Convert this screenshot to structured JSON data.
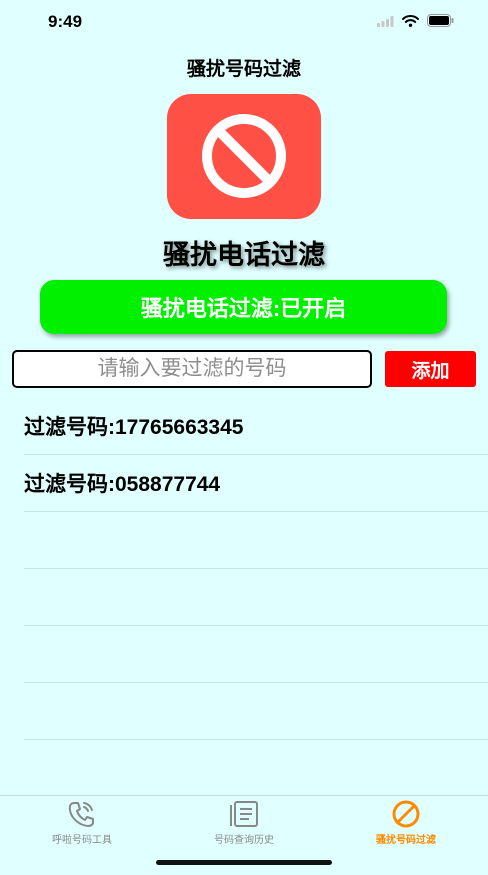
{
  "status_bar": {
    "time": "9:49"
  },
  "nav": {
    "title": "骚扰号码过滤"
  },
  "app_icon": {
    "name": "block-icon",
    "background": "#fe5045"
  },
  "heading": "骚扰电话过滤",
  "toggle": {
    "label": "骚扰电话过滤:已开启",
    "color": "#00f000"
  },
  "add_form": {
    "placeholder": "请输入要过滤的号码",
    "value": "",
    "button_label": "添加"
  },
  "filtered_numbers": [
    "过滤号码:17765663345",
    "过滤号码:058877744"
  ],
  "tabbar": {
    "tabs": [
      {
        "label": "呼啦号码工具",
        "icon": "phone-icon",
        "active": false
      },
      {
        "label": "号码查询历史",
        "icon": "document-icon",
        "active": false
      },
      {
        "label": "骚扰号码过滤",
        "icon": "block-icon",
        "active": true
      }
    ],
    "active_color": "#ff8a00"
  }
}
